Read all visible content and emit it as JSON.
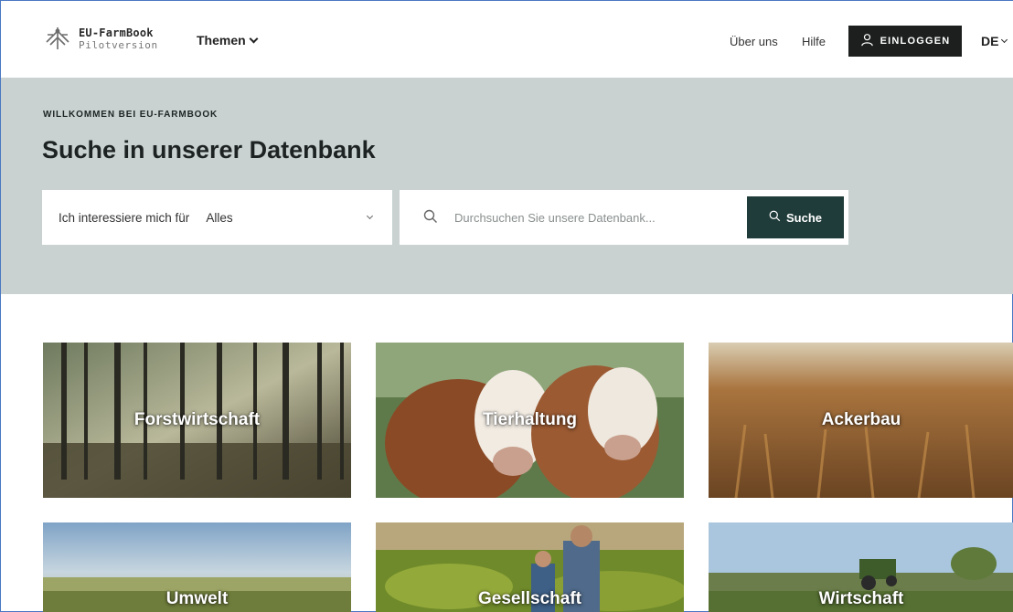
{
  "header": {
    "logo_title": "EU-FarmBook",
    "logo_subtitle": "Pilotversion",
    "themen_label": "Themen",
    "nav_about": "Über uns",
    "nav_help": "Hilfe",
    "login_label": "EINLOGGEN",
    "language": "DE"
  },
  "hero": {
    "kicker": "WILLKOMMEN BEI EU-FARMBOOK",
    "title": "Suche in unserer Datenbank",
    "filter_label": "Ich interessiere mich für",
    "filter_value": "Alles",
    "search_placeholder": "Durchsuchen Sie unsere Datenbank...",
    "search_button": "Suche"
  },
  "categories": [
    {
      "label": "Forstwirtschaft"
    },
    {
      "label": "Tierhaltung"
    },
    {
      "label": "Ackerbau"
    },
    {
      "label": "Umwelt"
    },
    {
      "label": "Gesellschaft"
    },
    {
      "label": "Wirtschaft"
    }
  ],
  "colors": {
    "hero_bg": "#c9d1d1",
    "login_bg": "#1d1f1f",
    "search_button_bg": "#1f3c3a"
  }
}
